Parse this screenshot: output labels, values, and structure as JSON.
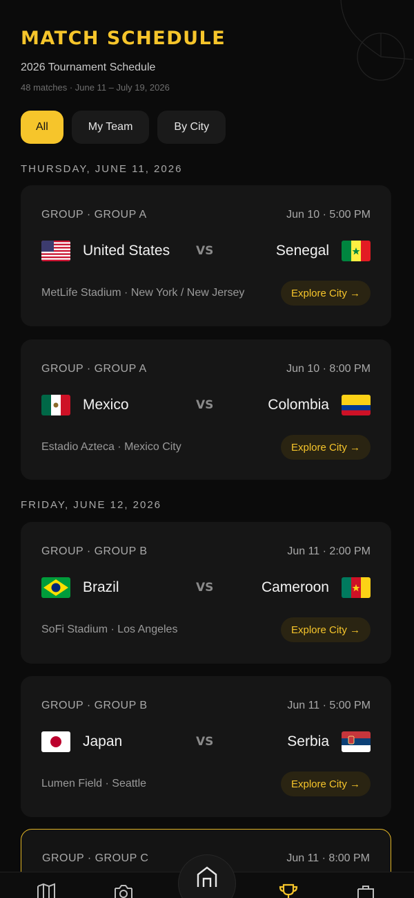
{
  "header": {
    "title": "MATCH SCHEDULE",
    "subtitle": "2026 Tournament Schedule",
    "meta": "48 matches · June 11 – July 19, 2026"
  },
  "filters": [
    {
      "label": "All",
      "active": true
    },
    {
      "label": "My Team",
      "active": false
    },
    {
      "label": "By City",
      "active": false
    }
  ],
  "days": [
    {
      "label": "THURSDAY, JUNE 11, 2026"
    },
    {
      "label": "FRIDAY, JUNE 12, 2026"
    }
  ],
  "matches": [
    {
      "group": "GROUP · GROUP A",
      "time": "Jun 10 · 5:00 PM",
      "home": "United States",
      "home_flag": "us-flag",
      "vs": "VS",
      "away": "Senegal",
      "away_flag": "senegal-flag",
      "venue": "MetLife Stadium · New York / New Jersey",
      "action": "Explore City →"
    },
    {
      "group": "GROUP · GROUP A",
      "time": "Jun 10 · 8:00 PM",
      "home": "Mexico",
      "home_flag": "mexico-flag",
      "vs": "VS",
      "away": "Colombia",
      "away_flag": "colombia-flag",
      "venue": "Estadio Azteca · Mexico City",
      "action": "Explore City →"
    },
    {
      "group": "GROUP · GROUP B",
      "time": "Jun 11 · 2:00 PM",
      "home": "Brazil",
      "home_flag": "brazil-flag",
      "vs": "VS",
      "away": "Cameroon",
      "away_flag": "cameroon-flag",
      "venue": "SoFi Stadium · Los Angeles",
      "action": "Explore City →"
    },
    {
      "group": "GROUP · GROUP B",
      "time": "Jun 11 · 5:00 PM",
      "home": "Japan",
      "home_flag": "japan-flag",
      "vs": "VS",
      "away": "Serbia",
      "away_flag": "serbia-flag",
      "venue": "Lumen Field · Seattle",
      "action": "Explore City →"
    },
    {
      "group": "GROUP · GROUP C",
      "time": "Jun 11 · 8:00 PM"
    }
  ],
  "nav": [
    "map-icon",
    "camera-icon",
    "home-icon",
    "trophy-icon",
    "briefcase-icon"
  ],
  "colors": {
    "accent": "#f6c52b",
    "background": "#0b0b0b",
    "card": "#161616"
  }
}
